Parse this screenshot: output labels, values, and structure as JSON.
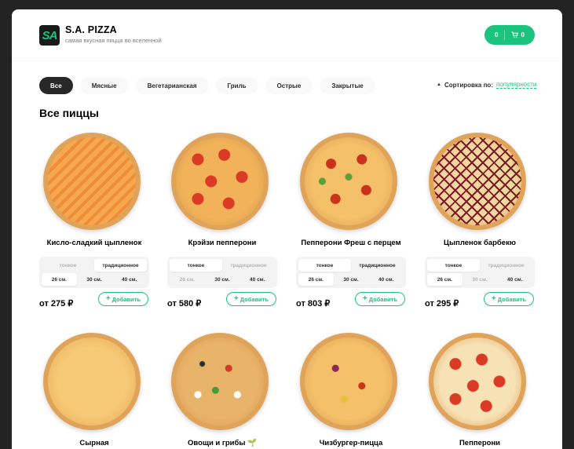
{
  "header": {
    "logo_text": "SA",
    "brand": "S.A. PIZZA",
    "tagline": "самая вкусная пицца во вселенной",
    "cart_total": "0",
    "cart_count": "0"
  },
  "categories": [
    "Все",
    "Мясные",
    "Вегетарианская",
    "Гриль",
    "Острые",
    "Закрытые"
  ],
  "sort": {
    "label": "Сортировка по:",
    "value": "популярности"
  },
  "section_title": "Все пиццы",
  "dough_types": [
    "тонкое",
    "традиционное"
  ],
  "sizes": [
    "26 см.",
    "30 см.",
    "40 см."
  ],
  "add_label": "Добавить",
  "pizzas": [
    {
      "name": "Кисло-сладкий цыпленок",
      "price": "от 275 ₽",
      "dough": {
        "тонкое": "off",
        "традиционное": "on"
      },
      "size": {
        "26": "on",
        "30": "",
        "40": ""
      }
    },
    {
      "name": "Крэйзи пепперони",
      "price": "от 580 ₽",
      "dough": {
        "тонкое": "on",
        "традиционное": "off"
      },
      "size": {
        "26": "off",
        "30": "",
        "40": ""
      }
    },
    {
      "name": "Пепперони Фреш с перцем",
      "price": "от 803 ₽",
      "dough": {
        "тонкое": "on",
        "традиционное": ""
      },
      "size": {
        "26": "on",
        "30": "",
        "40": ""
      }
    },
    {
      "name": "Цыпленок барбекю",
      "price": "от 295 ₽",
      "dough": {
        "тонкое": "on",
        "традиционное": "off"
      },
      "size": {
        "26": "on",
        "30": "off",
        "40": ""
      }
    },
    {
      "name": "Сырная"
    },
    {
      "name": "Овощи и грибы 🌱"
    },
    {
      "name": "Чизбургер-пицца"
    },
    {
      "name": "Пепперони"
    }
  ],
  "colors": {
    "accent": "#1bc47d",
    "dark": "#282828"
  }
}
